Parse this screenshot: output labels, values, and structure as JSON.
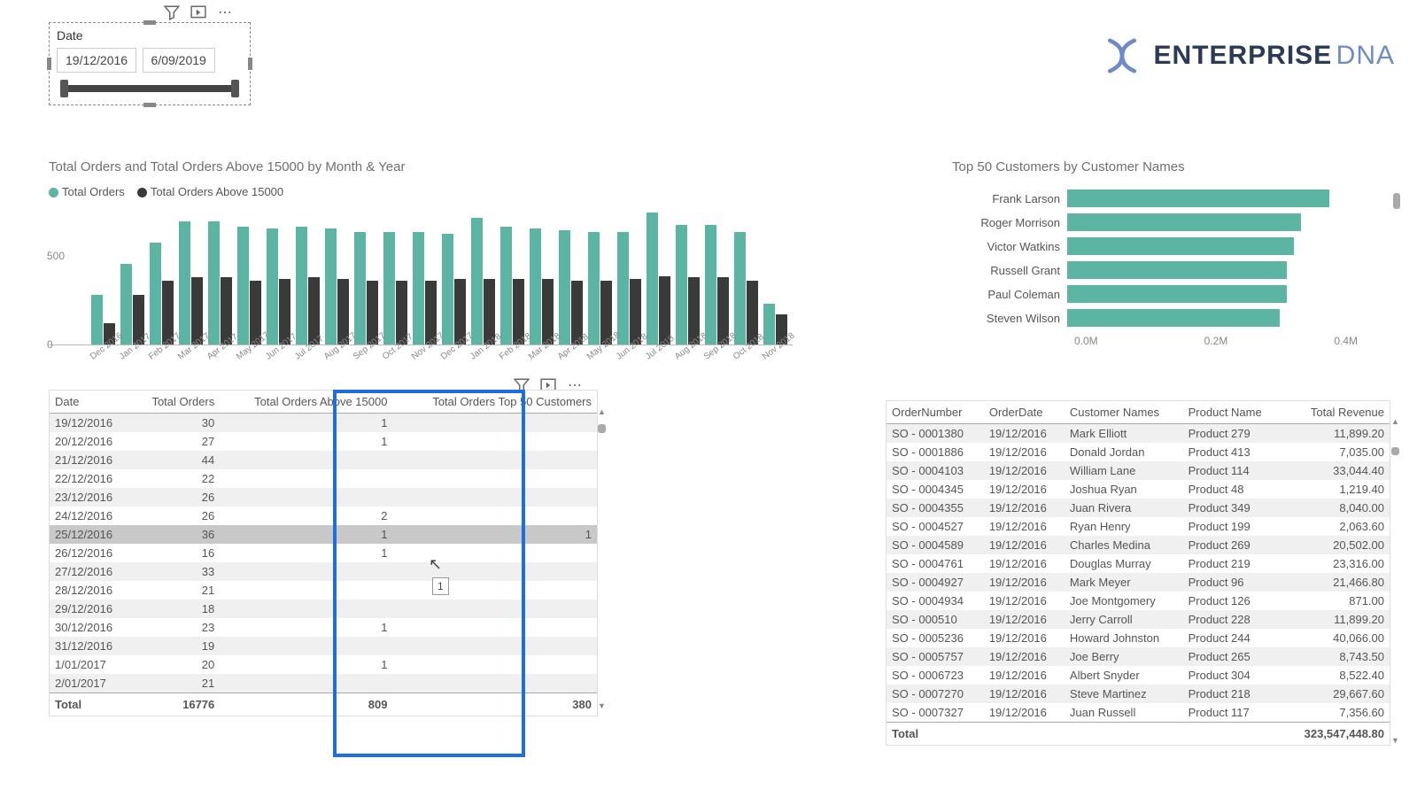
{
  "slicer": {
    "label": "Date",
    "from": "19/12/2016",
    "to": "6/09/2019"
  },
  "logo": {
    "t1": "ENTERPRISE",
    "t2": "DNA"
  },
  "chart_data": [
    {
      "type": "bar",
      "title": "Total Orders and Total Orders Above 15000 by Month & Year",
      "ylabel": "",
      "ylim": [
        0,
        800
      ],
      "yticks": [
        0,
        500
      ],
      "categories": [
        "Dec 2016",
        "Jan 2017",
        "Feb 2017",
        "Mar 2017",
        "Apr 2017",
        "May 2017",
        "Jun 2017",
        "Jul 2017",
        "Aug 2017",
        "Sep 2017",
        "Oct 2017",
        "Nov 2017",
        "Dec 2017",
        "Jan 2018",
        "Feb 2018",
        "Mar 2018",
        "Apr 2018",
        "May 2018",
        "Jun 2018",
        "Jul 2018",
        "Aug 2018",
        "Sep 2018",
        "Oct 2018",
        "Nov 2018"
      ],
      "series": [
        {
          "name": "Total Orders",
          "color": "#5bb5a2",
          "values": [
            280,
            460,
            580,
            700,
            700,
            670,
            660,
            670,
            660,
            640,
            640,
            640,
            630,
            720,
            670,
            660,
            650,
            640,
            640,
            750,
            680,
            680,
            640,
            230
          ]
        },
        {
          "name": "Total Orders Above 15000",
          "color": "#3a3a3a",
          "values": [
            120,
            280,
            360,
            380,
            380,
            360,
            370,
            380,
            370,
            360,
            360,
            360,
            370,
            370,
            370,
            370,
            360,
            360,
            370,
            390,
            380,
            380,
            360,
            170
          ]
        }
      ]
    },
    {
      "type": "bar",
      "orientation": "horizontal",
      "title": "Top 50 Customers by Customer Names",
      "xticks": [
        "0.0M",
        "0.2M",
        "0.4M"
      ],
      "xlim": [
        0,
        0.4
      ],
      "categories": [
        "Frank Larson",
        "Roger Morrison",
        "Victor Watkins",
        "Russell Grant",
        "Paul Coleman",
        "Steven Wilson"
      ],
      "values": [
        0.37,
        0.33,
        0.32,
        0.31,
        0.31,
        0.3
      ]
    }
  ],
  "table_left": {
    "headers": [
      "Date",
      "Total Orders",
      "Total Orders Above 15000",
      "Total Orders Top 50 Customers"
    ],
    "rows": [
      [
        "19/12/2016",
        "30",
        "1",
        ""
      ],
      [
        "20/12/2016",
        "27",
        "1",
        ""
      ],
      [
        "21/12/2016",
        "44",
        "",
        ""
      ],
      [
        "22/12/2016",
        "22",
        "",
        ""
      ],
      [
        "23/12/2016",
        "26",
        "",
        ""
      ],
      [
        "24/12/2016",
        "26",
        "2",
        ""
      ],
      [
        "25/12/2016",
        "36",
        "1",
        "1"
      ],
      [
        "26/12/2016",
        "16",
        "1",
        ""
      ],
      [
        "27/12/2016",
        "33",
        "",
        ""
      ],
      [
        "28/12/2016",
        "21",
        "",
        ""
      ],
      [
        "29/12/2016",
        "18",
        "",
        ""
      ],
      [
        "30/12/2016",
        "23",
        "1",
        ""
      ],
      [
        "31/12/2016",
        "19",
        "",
        ""
      ],
      [
        "1/01/2017",
        "20",
        "1",
        ""
      ],
      [
        "2/01/2017",
        "21",
        "",
        ""
      ]
    ],
    "footer": [
      "Total",
      "16776",
      "809",
      "380"
    ]
  },
  "tooltip": "1",
  "table_right": {
    "headers": [
      "OrderNumber",
      "OrderDate",
      "Customer Names",
      "Product Name",
      "Total Revenue"
    ],
    "rows": [
      [
        "SO - 0001380",
        "19/12/2016",
        "Mark Elliott",
        "Product 279",
        "11,899.20"
      ],
      [
        "SO - 0001886",
        "19/12/2016",
        "Donald Jordan",
        "Product 413",
        "7,035.00"
      ],
      [
        "SO - 0004103",
        "19/12/2016",
        "William Lane",
        "Product 114",
        "33,044.40"
      ],
      [
        "SO - 0004345",
        "19/12/2016",
        "Joshua Ryan",
        "Product 48",
        "1,219.40"
      ],
      [
        "SO - 0004355",
        "19/12/2016",
        "Juan Rivera",
        "Product 349",
        "8,040.00"
      ],
      [
        "SO - 0004527",
        "19/12/2016",
        "Ryan Henry",
        "Product 199",
        "2,063.60"
      ],
      [
        "SO - 0004589",
        "19/12/2016",
        "Charles Medina",
        "Product 269",
        "20,502.00"
      ],
      [
        "SO - 0004761",
        "19/12/2016",
        "Douglas Murray",
        "Product 219",
        "23,316.00"
      ],
      [
        "SO - 0004927",
        "19/12/2016",
        "Mark Meyer",
        "Product 96",
        "21,466.80"
      ],
      [
        "SO - 0004934",
        "19/12/2016",
        "Joe Montgomery",
        "Product 126",
        "871.00"
      ],
      [
        "SO - 000510",
        "19/12/2016",
        "Jerry Carroll",
        "Product 228",
        "11,899.20"
      ],
      [
        "SO - 0005236",
        "19/12/2016",
        "Howard Johnston",
        "Product 244",
        "40,066.00"
      ],
      [
        "SO - 0005757",
        "19/12/2016",
        "Joe Berry",
        "Product 265",
        "8,743.50"
      ],
      [
        "SO - 0006723",
        "19/12/2016",
        "Albert Snyder",
        "Product 304",
        "8,522.40"
      ],
      [
        "SO - 0007270",
        "19/12/2016",
        "Steve Martinez",
        "Product 218",
        "29,667.60"
      ],
      [
        "SO - 0007327",
        "19/12/2016",
        "Juan Russell",
        "Product 117",
        "7,356.60"
      ]
    ],
    "footer": [
      "Total",
      "",
      "",
      "",
      "323,547,448.80"
    ]
  }
}
